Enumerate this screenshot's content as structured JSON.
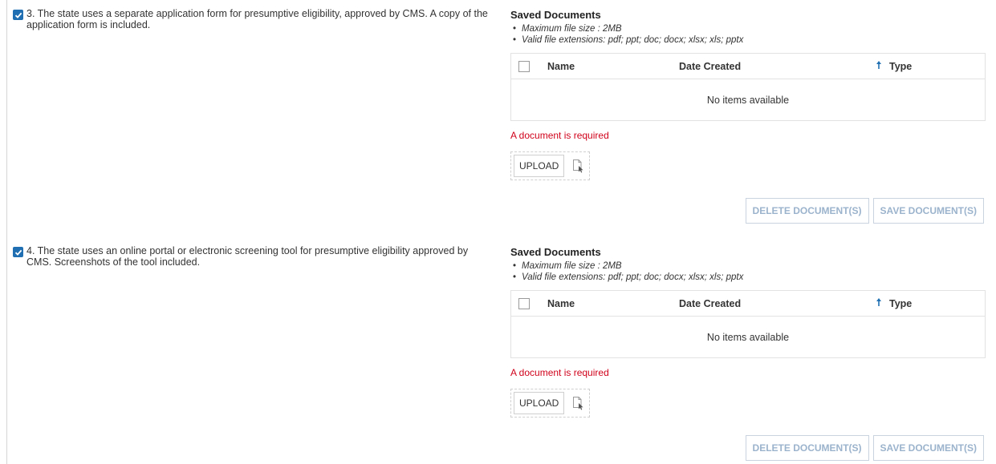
{
  "items": [
    {
      "checked": true,
      "question": "3. The state uses a separate application form for presumptive eligibility, approved by CMS. A copy of the application form is included.",
      "docs_title": "Saved Documents",
      "rules": [
        "Maximum file size : 2MB",
        "Valid file extensions: pdf; ppt; doc; docx; xlsx; xls; pptx"
      ],
      "columns": {
        "name": "Name",
        "date": "Date Created",
        "type": "Type"
      },
      "sort_icon": "sort-ascending-icon",
      "empty_text": "No items available",
      "error": "A document is required",
      "upload_label": "UPLOAD",
      "delete_label": "DELETE DOCUMENT(S)",
      "save_label": "SAVE DOCUMENT(S)"
    },
    {
      "checked": true,
      "question": "4. The state uses an online portal or electronic screening tool for presumptive eligibility approved by CMS. Screenshots of the tool included.",
      "docs_title": "Saved Documents",
      "rules": [
        "Maximum file size : 2MB",
        "Valid file extensions: pdf; ppt; doc; docx; xlsx; xls; pptx"
      ],
      "columns": {
        "name": "Name",
        "date": "Date Created",
        "type": "Type"
      },
      "sort_icon": "sort-ascending-icon",
      "empty_text": "No items available",
      "error": "A document is required",
      "upload_label": "UPLOAD",
      "delete_label": "DELETE DOCUMENT(S)",
      "save_label": "SAVE DOCUMENT(S)"
    }
  ],
  "colors": {
    "checkbox": "#1f6fb2",
    "error": "#d0021b",
    "disabled_text": "#9bb3cc"
  }
}
